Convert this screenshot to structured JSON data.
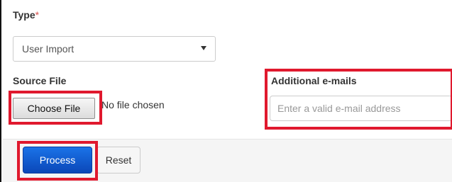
{
  "form": {
    "type_label": "Type",
    "required_marker": "*",
    "type_select": {
      "value": "User Import"
    },
    "source_file_label": "Source File",
    "choose_file_button": "Choose File",
    "no_file_text": "No file chosen",
    "emails_label": "Additional e-mails",
    "emails_input": {
      "placeholder": "Enter a valid e-mail address",
      "value": ""
    }
  },
  "footer": {
    "process_button": "Process",
    "reset_button": "Reset"
  },
  "icons": {
    "select_arrow": "chevron-down-icon"
  },
  "colors": {
    "primary_button": "#0b5ed7",
    "highlight_box": "#e0192e",
    "required_marker": "#d9534f"
  }
}
